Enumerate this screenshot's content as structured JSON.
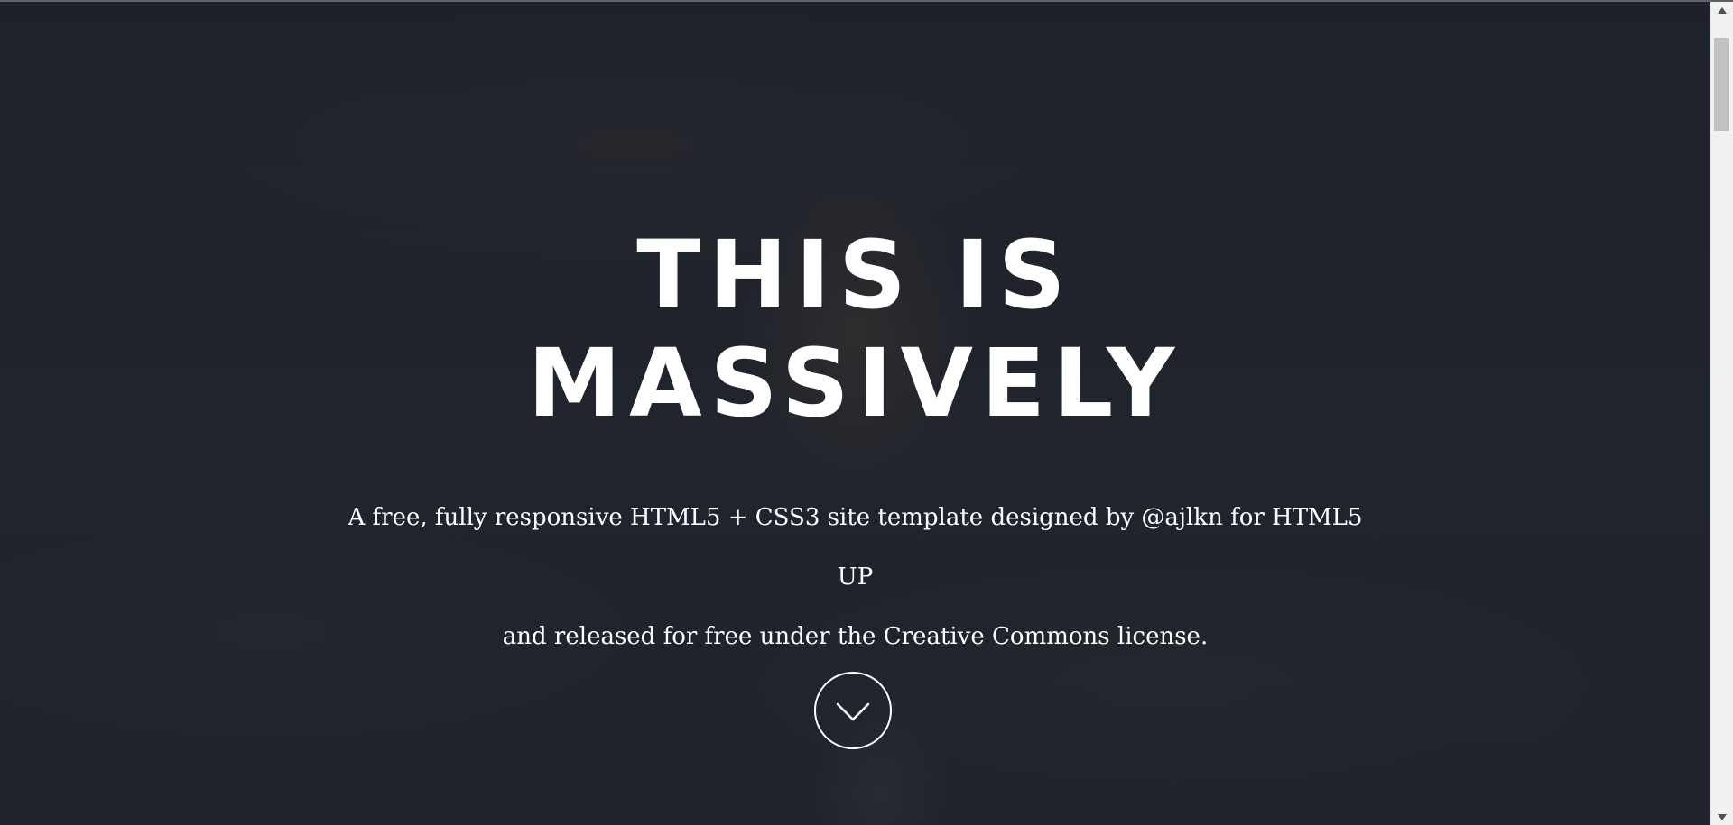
{
  "hero": {
    "title_line1": "THIS IS",
    "title_line2": "MASSIVELY",
    "description_line1": "A free, fully responsive HTML5 + CSS3 site template designed by @ajlkn for HTML5",
    "description_line2": "UP",
    "description_line3": "and released for free under the Creative Commons license.",
    "scroll_button_icon": "chevron-down-icon"
  },
  "colors": {
    "text": "#ffffff",
    "background": "#1f2228",
    "scrollbar_track": "#f1f1f1",
    "scrollbar_thumb": "#c1c1c1"
  },
  "scrollbar": {
    "up_icon": "triangle-up-icon",
    "down_icon": "triangle-down-icon"
  }
}
